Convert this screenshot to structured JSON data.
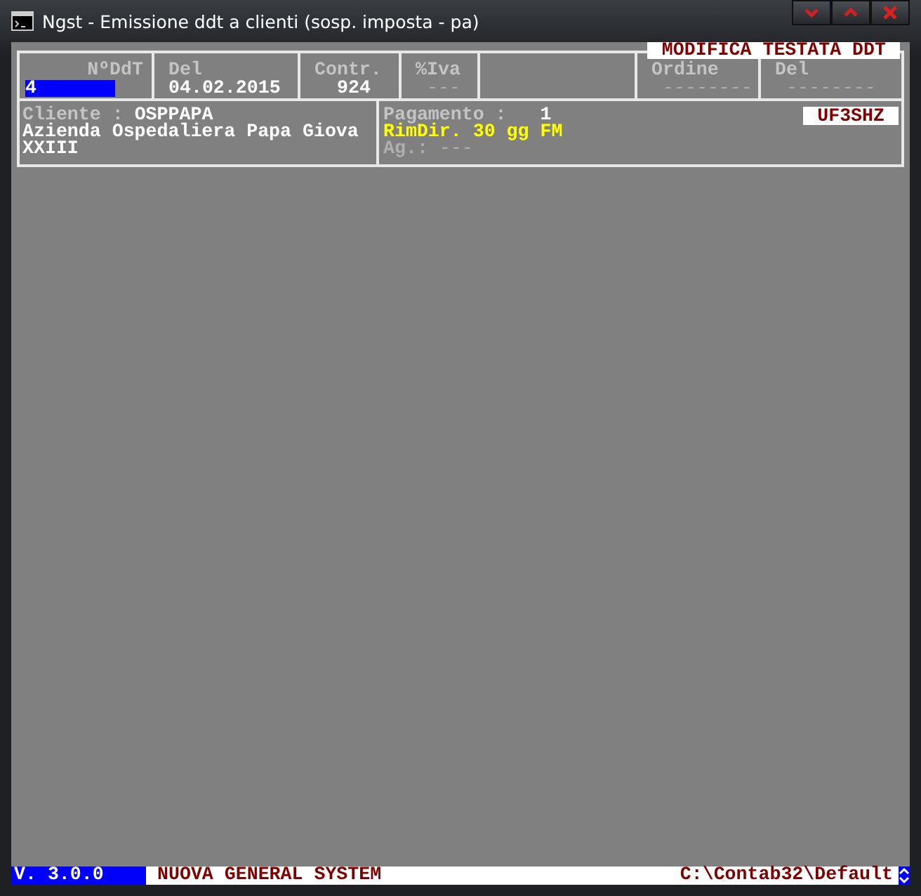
{
  "window": {
    "title": "Ngst - Emissione ddt a clienti (sosp. imposta - pa)"
  },
  "banner": "MODIFICA TESTATA DDT",
  "header_fields": [
    {
      "kind": "input",
      "label": "NºDdT",
      "value": "4"
    },
    {
      "kind": "text",
      "label": "Del",
      "value": "04.02.2015"
    },
    {
      "kind": "number",
      "label": "Contr.",
      "value": "924"
    },
    {
      "kind": "dim",
      "label": "%Iva",
      "value": "---"
    },
    {
      "kind": "empty"
    },
    {
      "kind": "dim",
      "label": "Ordine",
      "value": "--------"
    },
    {
      "kind": "dim",
      "label": "Del",
      "value": "--------"
    }
  ],
  "customer": {
    "label": "Cliente :",
    "code": "OSPPAPA",
    "name": "Azienda Ospedaliera Papa Giova",
    "name_2": "XXIII"
  },
  "payment": {
    "label": "Pagamento :",
    "code": "1",
    "description": "RimDir. 30 gg FM",
    "agent_label": "Ag.:",
    "agent": "---"
  },
  "code_badge": "UF3SHZ",
  "status_bar": {
    "version": "V. 3.0.0",
    "system": "NUOVA GENERAL SYSTEM",
    "path": "C:\\Contab32\\Default"
  }
}
